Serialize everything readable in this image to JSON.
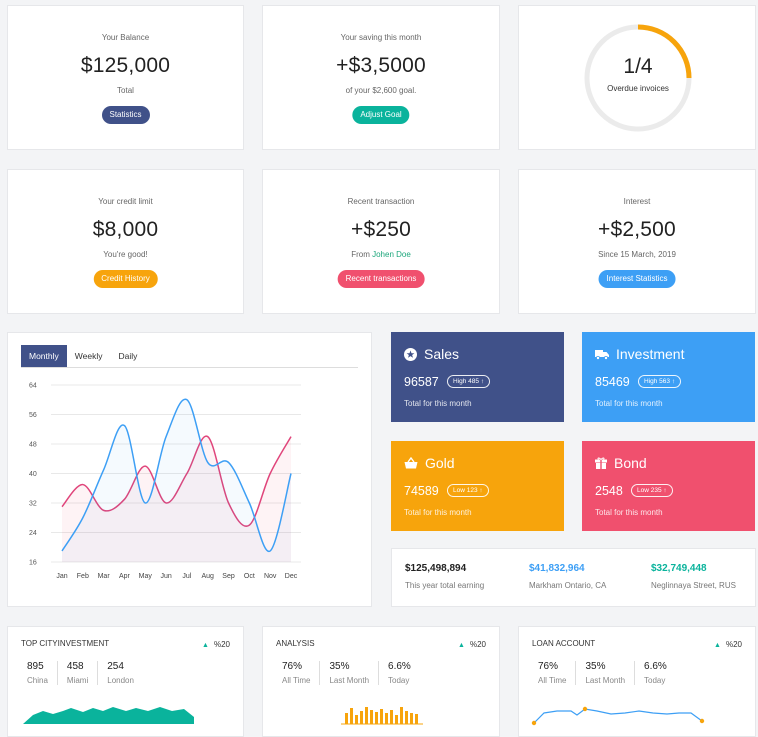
{
  "stats": [
    {
      "label": "Your Balance",
      "value": "$125,000",
      "sub": "Total",
      "button": "Statistics",
      "button_color": "#405189"
    },
    {
      "label": "Your saving this month",
      "value": "+$3,5000",
      "sub": "of your $2,600 goal.",
      "button": "Adjust Goal",
      "button_color": "#0ab39c"
    },
    {
      "label": "Your credit limit",
      "value": "$8,000",
      "sub": "You're good!",
      "button": "Credit History",
      "button_color": "#f7a40c"
    },
    {
      "label": "Recent transaction",
      "value": "+$250",
      "sub_prefix": "From",
      "sub_name": "Johen Doe",
      "button": "Recent transactions",
      "button_color": "#f0506e"
    },
    {
      "label": "Interest",
      "value": "+$2,500",
      "sub": "Since 15 March, 2019",
      "button": "Interest Statistics",
      "button_color": "#3d9ff5"
    }
  ],
  "overdue": {
    "value": "1/4",
    "label": "Overdue invoices",
    "fraction": 0.25,
    "color": "#f7a40c"
  },
  "chart_tabs": [
    "Monthly",
    "Weekly",
    "Daily"
  ],
  "chart_data": {
    "type": "line",
    "categories": [
      "Jan",
      "Feb",
      "Mar",
      "Apr",
      "May",
      "Jun",
      "Jul",
      "Aug",
      "Sep",
      "Oct",
      "Nov",
      "Dec"
    ],
    "yticks": [
      16,
      24,
      32,
      40,
      48,
      56,
      64
    ],
    "ylim": [
      16,
      64
    ],
    "series": [
      {
        "color": "#e0457b",
        "values": [
          31,
          37,
          30,
          33,
          42,
          32,
          40,
          50,
          32,
          26,
          40,
          50
        ]
      },
      {
        "color": "#3d9ff5",
        "values": [
          19,
          28,
          41,
          53,
          32,
          50,
          60,
          43,
          43,
          32,
          19,
          40
        ]
      }
    ]
  },
  "tiles": [
    {
      "icon": "star-icon",
      "title": "Sales",
      "value": "96587",
      "badge": "High 485",
      "footer": "Total for this month",
      "color": "#405189"
    },
    {
      "icon": "truck-icon",
      "title": "Investment",
      "value": "85469",
      "badge": "High 563",
      "footer": "Total for this month",
      "color": "#3d9ff5"
    },
    {
      "icon": "basket-icon",
      "title": "Gold",
      "value": "74589",
      "badge": "Low 123",
      "footer": "Total for this month",
      "color": "#f7a40c"
    },
    {
      "icon": "gift-icon",
      "title": "Bond",
      "value": "2548",
      "badge": "Low 235",
      "footer": "Total for this month",
      "color": "#f0506e"
    }
  ],
  "earnings": [
    {
      "value": "$125,498,894",
      "label": "This year total earning",
      "color": "#222222"
    },
    {
      "value": "$41,832,964",
      "label": "Markham Ontario, CA",
      "color": "#3d9ff5"
    },
    {
      "value": "$32,749,448",
      "label": "Neglinnaya Street, RUS",
      "color": "#0ab39c"
    }
  ],
  "minis": [
    {
      "title": "TOP CITYINVESTMENT",
      "pct": "%20",
      "cols": [
        {
          "a": "895",
          "b": "China"
        },
        {
          "a": "458",
          "b": "Miami"
        },
        {
          "a": "254",
          "b": "London"
        }
      ]
    },
    {
      "title": "ANALYSIS",
      "pct": "%20",
      "cols": [
        {
          "a": "76%",
          "b": "All Time"
        },
        {
          "a": "35%",
          "b": "Last Month"
        },
        {
          "a": "6.6%",
          "b": "Today"
        }
      ]
    },
    {
      "title": "LOAN ACCOUNT",
      "pct": "%20",
      "cols": [
        {
          "a": "76%",
          "b": "All Time"
        },
        {
          "a": "35%",
          "b": "Last Month"
        },
        {
          "a": "6.6%",
          "b": "Today"
        }
      ]
    }
  ],
  "colors": {
    "green": "#0ab39c",
    "orange": "#f7a40c",
    "blue": "#3d9ff5"
  }
}
